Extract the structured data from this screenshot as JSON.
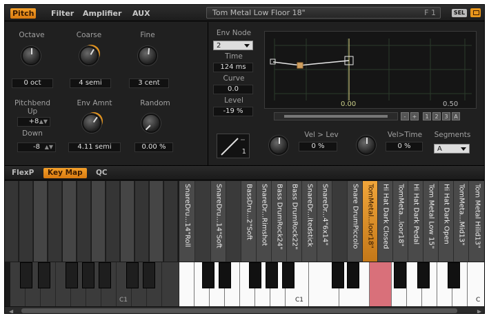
{
  "tabs": [
    "Pitch",
    "Filter",
    "Amplifier",
    "AUX"
  ],
  "preset": {
    "name": "Tom Metal Low Floor 18\"",
    "slot": "F 1"
  },
  "sel_label": "SEL",
  "pitch": {
    "octave": {
      "label": "Octave",
      "value": "0 oct"
    },
    "coarse": {
      "label": "Coarse",
      "value": "4 semi"
    },
    "fine": {
      "label": "Fine",
      "value": "3 cent"
    },
    "pitchbend": {
      "label_top": "Pitchbend",
      "label_up": "Up",
      "up_value": "+8",
      "label_down": "Down",
      "down_value": "-8"
    },
    "env_amnt": {
      "label": "Env Amnt",
      "value": "4.11 semi"
    },
    "random": {
      "label": "Random",
      "value": "0.00 %"
    }
  },
  "env": {
    "node_label": "Env Node",
    "node_value": "2",
    "time_label": "Time",
    "time_value": "124 ms",
    "curve_label": "Curve",
    "curve_value": "0.0",
    "level_label": "Level",
    "level_value": "-19 %",
    "graph_marks": [
      "0.00",
      "0.50"
    ],
    "zoom_buttons": [
      "-",
      "+",
      "1",
      "2",
      "3",
      "A"
    ],
    "curve_shape_value": "1",
    "vel_lev_label": "Vel > Lev",
    "vel_lev_value": "0 %",
    "vel_time_label": "Vel>Time",
    "vel_time_value": "0 %",
    "segments_label": "Segments",
    "segments_value": "A"
  },
  "subtabs": [
    "FlexP",
    "Key Map",
    "QC"
  ],
  "keymap": {
    "slots": [
      "SnareDru...14\"Roll",
      "SnareDru...14\"Soft",
      "BassDru...2\"Soft",
      "SnareDr...Rimshot",
      "Bass DrumRock24\"",
      "Bass DrumRock22\"",
      "SnareDr...itedstick",
      "SnareDr...4\"6x14\"",
      "Snare DrumPiccolo",
      "TomMetal...loor18\"",
      "Hi Hat Dark Closed",
      "TomMeta...loor18\"",
      "Hi Hat Dark Pedal",
      "Tom Metal Low 15\"",
      "Hi Hat Dark Open",
      "TomMeta...Mid13\"",
      "Tom Metal Hilid13\""
    ],
    "key_labels": [
      "C1",
      "C1",
      "C"
    ]
  }
}
